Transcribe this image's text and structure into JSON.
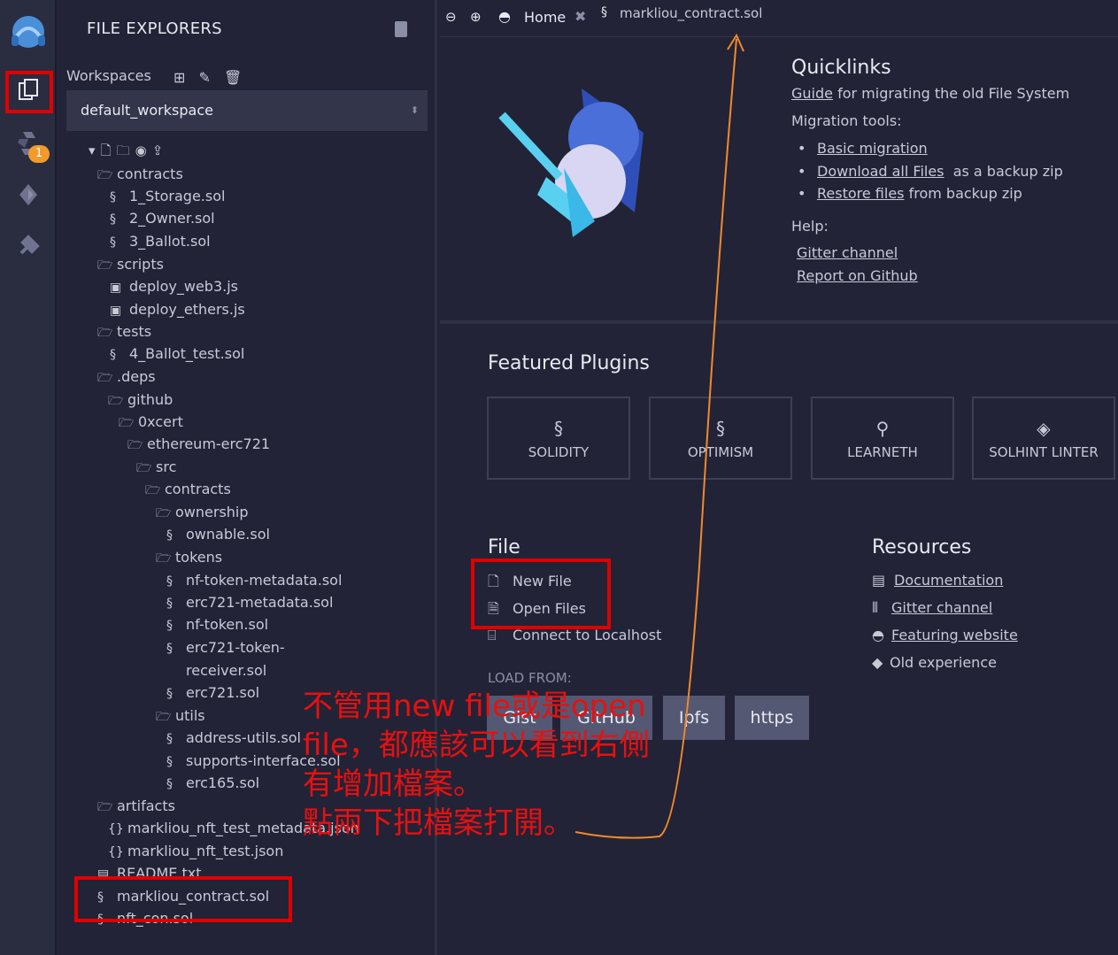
{
  "explorer": {
    "title": "FILE EXPLORERS",
    "workspaces_label": "Workspaces",
    "workspace_selected": "default_workspace",
    "tree": [
      {
        "label": "contracts",
        "type": "folder"
      },
      {
        "label": "1_Storage.sol",
        "type": "sol"
      },
      {
        "label": "2_Owner.sol",
        "type": "sol"
      },
      {
        "label": "3_Ballot.sol",
        "type": "sol"
      },
      {
        "label": "scripts",
        "type": "folder"
      },
      {
        "label": "deploy_web3.js",
        "type": "js"
      },
      {
        "label": "deploy_ethers.js",
        "type": "js"
      },
      {
        "label": "tests",
        "type": "folder"
      },
      {
        "label": "4_Ballot_test.sol",
        "type": "sol"
      },
      {
        "label": ".deps",
        "type": "folder"
      },
      {
        "label": "github",
        "type": "folder"
      },
      {
        "label": "0xcert",
        "type": "folder"
      },
      {
        "label": "ethereum-erc721",
        "type": "folder"
      },
      {
        "label": "src",
        "type": "folder"
      },
      {
        "label": "contracts",
        "type": "folder"
      },
      {
        "label": "ownership",
        "type": "folder"
      },
      {
        "label": "ownable.sol",
        "type": "sol"
      },
      {
        "label": "tokens",
        "type": "folder"
      },
      {
        "label": "nf-token-metadata.sol",
        "type": "sol"
      },
      {
        "label": "erc721-metadata.sol",
        "type": "sol"
      },
      {
        "label": "nf-token.sol",
        "type": "sol"
      },
      {
        "label": "erc721-token-",
        "type": "sol"
      },
      {
        "label": "receiver.sol",
        "type": "cont"
      },
      {
        "label": "erc721.sol",
        "type": "sol"
      },
      {
        "label": "utils",
        "type": "folder"
      },
      {
        "label": "address-utils.sol",
        "type": "sol"
      },
      {
        "label": "supports-interface.sol",
        "type": "sol"
      },
      {
        "label": "erc165.sol",
        "type": "sol"
      },
      {
        "label": "artifacts",
        "type": "folder"
      },
      {
        "label": "markliou_nft_test_metadata.json",
        "type": "json"
      },
      {
        "label": "markliou_nft_test.json",
        "type": "json"
      },
      {
        "label": "README.txt",
        "type": "txt"
      },
      {
        "label": "markliou_contract.sol",
        "type": "sol"
      },
      {
        "label": "nft_con.sol",
        "type": "sol"
      }
    ]
  },
  "iconbar": {
    "badge": "1"
  },
  "tabs": {
    "home": "Home",
    "file": "markliou_contract.sol"
  },
  "quicklinks": {
    "title": "Quicklinks",
    "guide_link": "Guide",
    "guide_rest": " for migrating the old File System",
    "migration_label": "Migration tools:",
    "items": [
      {
        "link": "Basic migration",
        "rest": ""
      },
      {
        "link": "Download all Files",
        "rest": "  as a backup zip"
      },
      {
        "link": "Restore files",
        "rest": " from backup zip"
      }
    ],
    "help_label": "Help:",
    "help": [
      "Gitter channel",
      "Report on Github"
    ]
  },
  "featured": {
    "title": "Featured Plugins",
    "plugins": [
      "SOLIDITY",
      "OPTIMISM",
      "LEARNETH",
      "SOLHINT LINTER"
    ]
  },
  "file_section": {
    "title": "File",
    "new_file": "New File",
    "open_files": "Open Files",
    "connect": "Connect to Localhost",
    "load_from": "LOAD FROM:",
    "buttons": [
      "Gist",
      "GitHub",
      "Ipfs",
      "https"
    ]
  },
  "resources": {
    "title": "Resources",
    "items": [
      "Documentation",
      "Gitter channel",
      "Featuring website",
      "Old experience"
    ]
  },
  "annotation": {
    "lines": [
      "不管用new file或是open",
      "file，都應該可以看到右側",
      "有增加檔案。",
      "點兩下把檔案打開。"
    ]
  },
  "colors": {
    "accent": "#e00000",
    "arrow": "#f08a2e",
    "bg": "#222336"
  }
}
